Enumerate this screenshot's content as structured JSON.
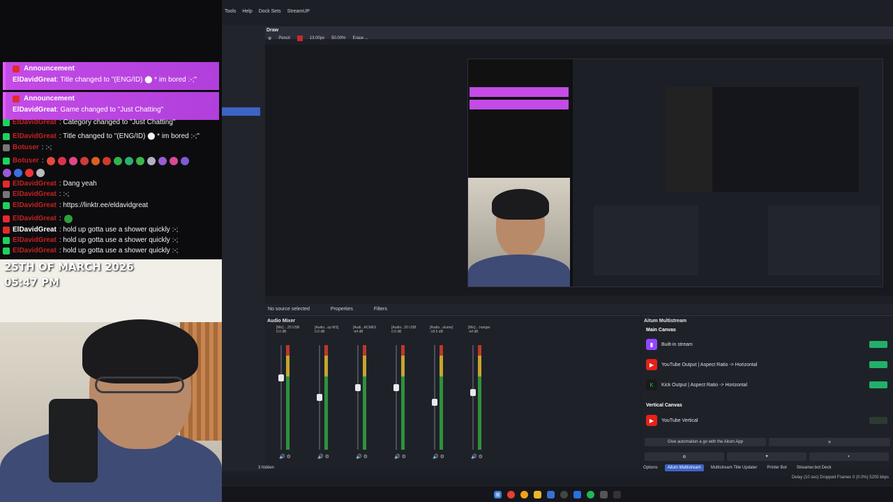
{
  "chat": {
    "announcements": [
      {
        "title": "Announcement",
        "user": "ElDavidGreat",
        "text": ": Title changed to \"(ENG/ID) ⬤ * im bored :-;\""
      },
      {
        "title": "Announcement",
        "user": "ElDavidGreat",
        "text": ": Game changed to \"Just Chatting\""
      }
    ],
    "messages": [
      {
        "user": "ElDavidGreat",
        "text": ": Category changed to \"Just Chatting\"",
        "badge": "green"
      },
      {
        "user": "ElDavidGreat",
        "text": ": Title changed to \"(ENG/ID) ⬤ * im bored :-;\"",
        "badge": "green"
      },
      {
        "user": "Botuser",
        "text": ": :-;",
        "badge": "gray"
      },
      {
        "user": "Botuser",
        "text": ":",
        "badge": "green"
      },
      {
        "user": "ElDavidGreat",
        "text": ": Dang yeah",
        "badge": "red"
      },
      {
        "user": "ElDavidGreat",
        "text": ": :-;",
        "badge": "gray"
      },
      {
        "user": "ElDavidGreat",
        "text": ": https://linktr.ee/eldavidgreat",
        "badge": "green"
      },
      {
        "user": "ElDavidGreat",
        "text": ":",
        "badge": "red"
      },
      {
        "user": "ElDavidGreat",
        "text": ": hold up gotta use a shower quickly :-;",
        "badge": "red",
        "highlight": true
      },
      {
        "user": "ElDavidGreat",
        "text": ": hold up gotta use a shower quickly :-;",
        "badge": "green"
      },
      {
        "user": "ElDavidGreat",
        "text": ": hold up gotta use a shower quickly :-;",
        "badge": "green"
      }
    ]
  },
  "webcam": {
    "date": "25TH OF MARCH 2026",
    "time": "05:47 PM"
  },
  "obs": {
    "menu": [
      "Tools",
      "Help",
      "Dock Sets",
      "StreamUP"
    ],
    "draw": {
      "title": "Draw",
      "tool": "Pencil",
      "size": "13.00px",
      "opacity": "50.00%",
      "erase": "Erase ..."
    },
    "source_bar": {
      "none": "No source selected",
      "properties": "Properties",
      "filters": "Filters"
    },
    "mixer": {
      "title": "Audio Mixer",
      "channels": [
        {
          "name": "[Mic] ...20 USB",
          "db": "0.0 dB",
          "meter": 0.7
        },
        {
          "name": "[Audio...op MS]",
          "db": "0.0 dB",
          "meter": 0.5
        },
        {
          "name": "[Audi...ACMES",
          "db": "-inf dB",
          "meter": 0.6
        },
        {
          "name": "[Audio...20 USB",
          "db": "0.0 dB",
          "meter": 0.6
        },
        {
          "name": "[Audio...olume]",
          "db": "-18.5 dB",
          "meter": 0.45
        },
        {
          "name": "[Mic] ...hanger",
          "db": "-inf dB",
          "meter": 0.55
        }
      ]
    },
    "multistream": {
      "title": "Aitum Multistream",
      "main_canvas": "Main Canvas",
      "vertical_canvas": "Vertical Canvas",
      "rows": [
        {
          "label": "Built-in stream",
          "icon": "twitch-icon",
          "color": "#9146ff",
          "on": true
        },
        {
          "label": "YouTube Output | Aspect Ratio -> Horizontal",
          "icon": "youtube-icon",
          "color": "#e62117",
          "on": true
        },
        {
          "label": "Kick Output | Aspect Ratio -> Horizontal",
          "icon": "kick-icon",
          "color": "#00c853",
          "on": true
        }
      ],
      "vertical_rows": [
        {
          "label": "YouTube Vertical",
          "icon": "youtube-icon",
          "color": "#e62117",
          "on": false
        }
      ],
      "automation": "Give automation a go with the Aitum App"
    },
    "dock_tabs": [
      "Aitum Multistream",
      "Multistream Title Updater",
      "Printer Bot",
      "Streamer.bot Deck"
    ],
    "options": "Options",
    "hidden": "3 hidden",
    "status": "Delay (10 sec)  Dropped Frames 0 (0.0%)  5205 kbps"
  },
  "colors": {
    "accent": "#3d63c5",
    "twitch": "#9146ff",
    "youtube": "#e62117",
    "kick": "#00c853"
  }
}
